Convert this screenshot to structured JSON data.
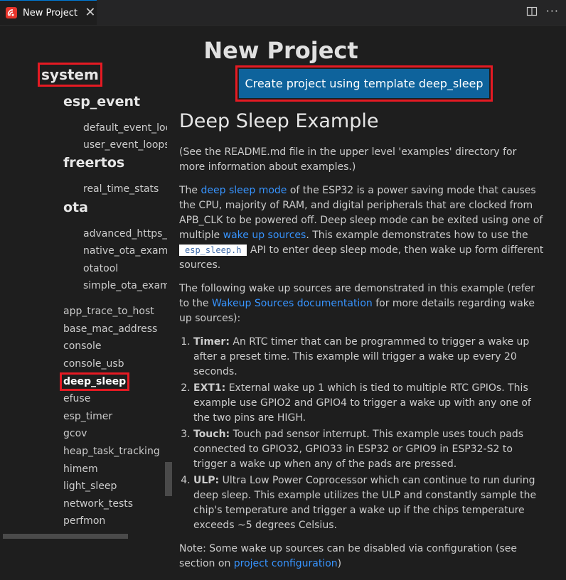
{
  "tab": {
    "title": "New Project",
    "close_glyph": "✕",
    "icon": "espressif-logo-icon"
  },
  "tab_actions": {
    "split": "split-editor-icon",
    "more": "···"
  },
  "page": {
    "title": "New Project",
    "create_button": "Create project using template deep_sleep"
  },
  "sidebar": {
    "group": "system",
    "subgroups": [
      {
        "title": "esp_event",
        "items": [
          "default_event_loop",
          "user_event_loops"
        ]
      },
      {
        "title": "freertos",
        "items": [
          "real_time_stats"
        ]
      },
      {
        "title": "ota",
        "items": [
          "advanced_https_ota",
          "native_ota_example",
          "otatool",
          "simple_ota_example"
        ]
      }
    ],
    "items": [
      "app_trace_to_host",
      "base_mac_address",
      "console",
      "console_usb",
      "deep_sleep",
      "efuse",
      "esp_timer",
      "gcov",
      "heap_task_tracking",
      "himem",
      "light_sleep",
      "network_tests",
      "perfmon"
    ],
    "selected": "deep_sleep"
  },
  "readme": {
    "heading": "Deep Sleep Example",
    "intro": "(See the README.md file in the upper level 'examples' directory for more information about examples.)",
    "p1": {
      "a": "The ",
      "link1": "deep sleep mode",
      "b": " of the ESP32 is a power saving mode that causes the CPU, majority of RAM, and digital peripherals that are clocked from APB_CLK to be powered off. Deep sleep mode can be exited using one of multiple ",
      "link2": "wake up sources",
      "c": ". This example demonstrates how to use the ",
      "code": "esp_sleep.h",
      "d": " API to enter deep sleep mode, then wake up form different sources."
    },
    "p2": {
      "a": "The following wake up sources are demonstrated in this example (refer to the ",
      "link": "Wakeup Sources documentation",
      "b": " for more details regarding wake up sources):"
    },
    "list": [
      {
        "term": "Timer:",
        "text": " An RTC timer that can be programmed to trigger a wake up after a preset time. This example will trigger a wake up every 20 seconds."
      },
      {
        "term": "EXT1:",
        "text": " External wake up 1 which is tied to multiple RTC GPIOs. This example use GPIO2 and GPIO4 to trigger a wake up with any one of the two pins are HIGH."
      },
      {
        "term": "Touch:",
        "text": " Touch pad sensor interrupt. This example uses touch pads connected to GPIO32, GPIO33 in ESP32 or GPIO9 in ESP32-S2 to trigger a wake up when any of the pads are pressed."
      },
      {
        "term": "ULP:",
        "text": " Ultra Low Power Coprocessor which can continue to run during deep sleep. This example utilizes the ULP and constantly sample the chip's temperature and trigger a wake up if the chips temperature exceeds ~5 degrees Celsius."
      }
    ],
    "note": {
      "a": "Note: Some wake up sources can be disabled via configuration (see section on ",
      "link": "project configuration",
      "b": ")"
    }
  },
  "colors": {
    "accent": "#0e639c",
    "link": "#3794ff",
    "highlight": "#e51a23",
    "background": "#1e1e1e"
  }
}
